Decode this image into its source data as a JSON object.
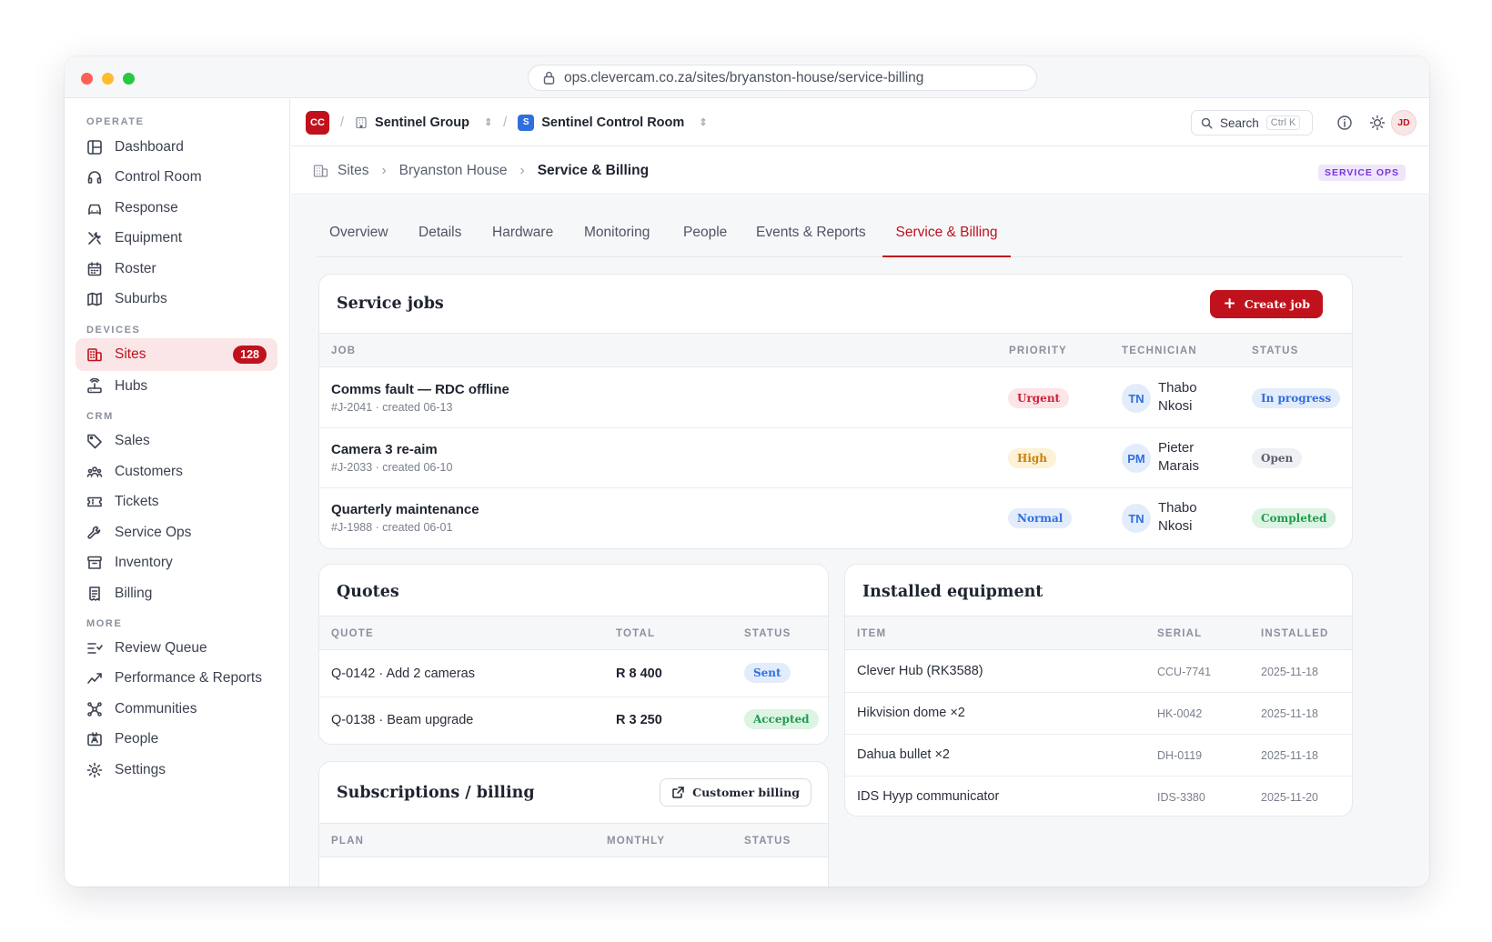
{
  "browser": {
    "url": "ops.clevercam.co.za/sites/bryanston-house/service-billing"
  },
  "sidebar": {
    "sections": {
      "operate": "OPERATE",
      "devices": "DEVICES",
      "crm": "CRM",
      "more": "MORE"
    },
    "items": [
      {
        "label": "Dashboard",
        "icon": "layout-icon"
      },
      {
        "label": "Control Room",
        "icon": "headset-icon"
      },
      {
        "label": "Response",
        "icon": "car-icon"
      },
      {
        "label": "Equipment",
        "icon": "tools-icon"
      },
      {
        "label": "Roster",
        "icon": "calendar-icon"
      },
      {
        "label": "Suburbs",
        "icon": "map-icon"
      },
      {
        "label": "Sites",
        "icon": "building-icon",
        "badge": "128",
        "active": true
      },
      {
        "label": "Hubs",
        "icon": "router-icon"
      },
      {
        "label": "Sales",
        "icon": "tag-icon"
      },
      {
        "label": "Customers",
        "icon": "users-icon"
      },
      {
        "label": "Tickets",
        "icon": "ticket-icon"
      },
      {
        "label": "Service Ops",
        "icon": "wrench-icon"
      },
      {
        "label": "Inventory",
        "icon": "archive-icon"
      },
      {
        "label": "Billing",
        "icon": "receipt-icon"
      },
      {
        "label": "Review Queue",
        "icon": "list-check-icon"
      },
      {
        "label": "Performance & Reports",
        "icon": "trend-icon"
      },
      {
        "label": "Communities",
        "icon": "network-icon"
      },
      {
        "label": "People",
        "icon": "id-card-icon"
      },
      {
        "label": "Settings",
        "icon": "gear-icon"
      }
    ]
  },
  "topbar": {
    "logo": "CC",
    "org": "Sentinel Group",
    "workspace_badge": "S",
    "workspace": "Sentinel Control Room",
    "search_label": "Search",
    "search_shortcut": "Ctrl K",
    "user_initials": "JD"
  },
  "breadcrumb": {
    "items": [
      "Sites",
      "Bryanston House",
      "Service & Billing"
    ],
    "tag": "SERVICE OPS"
  },
  "tabs": [
    "Overview",
    "Details",
    "Hardware",
    "Monitoring",
    "People",
    "Events & Reports",
    "Service & Billing"
  ],
  "service_jobs": {
    "title": "Service jobs",
    "create_label": "Create job",
    "columns": [
      "JOB",
      "PRIORITY",
      "TECHNICIAN",
      "STATUS"
    ],
    "rows": [
      {
        "title": "Comms fault — RDC offline",
        "meta": "#J-2041 · created 06-13",
        "priority": "Urgent",
        "tech_initials": "TN",
        "tech_first": "Thabo",
        "tech_last": "Nkosi",
        "status": "In progress"
      },
      {
        "title": "Camera 3 re-aim",
        "meta": "#J-2033 · created 06-10",
        "priority": "High",
        "tech_initials": "PM",
        "tech_first": "Pieter",
        "tech_last": "Marais",
        "status": "Open"
      },
      {
        "title": "Quarterly maintenance",
        "meta": "#J-1988 · created 06-01",
        "priority": "Normal",
        "tech_initials": "TN",
        "tech_first": "Thabo",
        "tech_last": "Nkosi",
        "status": "Completed"
      }
    ]
  },
  "quotes": {
    "title": "Quotes",
    "columns": [
      "QUOTE",
      "TOTAL",
      "STATUS"
    ],
    "rows": [
      {
        "quote": "Q-0142 · Add 2 cameras",
        "total": "R 8 400",
        "status": "Sent"
      },
      {
        "quote": "Q-0138 · Beam upgrade",
        "total": "R 3 250",
        "status": "Accepted"
      }
    ]
  },
  "subscriptions": {
    "title": "Subscriptions / billing",
    "button_label": "Customer billing",
    "columns": [
      "PLAN",
      "MONTHLY",
      "STATUS"
    ]
  },
  "equipment": {
    "title": "Installed equipment",
    "columns": [
      "ITEM",
      "SERIAL",
      "INSTALLED"
    ],
    "rows": [
      {
        "item": "Clever Hub (RK3588)",
        "serial": "CCU-7741",
        "installed": "2025-11-18"
      },
      {
        "item": "Hikvision dome ×2",
        "serial": "HK-0042",
        "installed": "2025-11-18"
      },
      {
        "item": "Dahua bullet ×2",
        "serial": "DH-0119",
        "installed": "2025-11-18"
      },
      {
        "item": "IDS Hyyp communicator",
        "serial": "IDS-3380",
        "installed": "2025-11-20"
      }
    ]
  },
  "colors": {
    "brand": "#c0121c",
    "urgent_bg": "#fde4e7",
    "urgent_fg": "#d0213a",
    "high_bg": "#fdf1d6",
    "high_fg": "#c98309",
    "normal_bg": "#e3ecfb",
    "normal_fg": "#2f6fe0",
    "progress_bg": "#e3ecfb",
    "progress_fg": "#2f6fe0",
    "open_bg": "#eef0f3",
    "open_fg": "#5a6070",
    "done_bg": "#ddf3e4",
    "done_fg": "#1f9d4c"
  }
}
